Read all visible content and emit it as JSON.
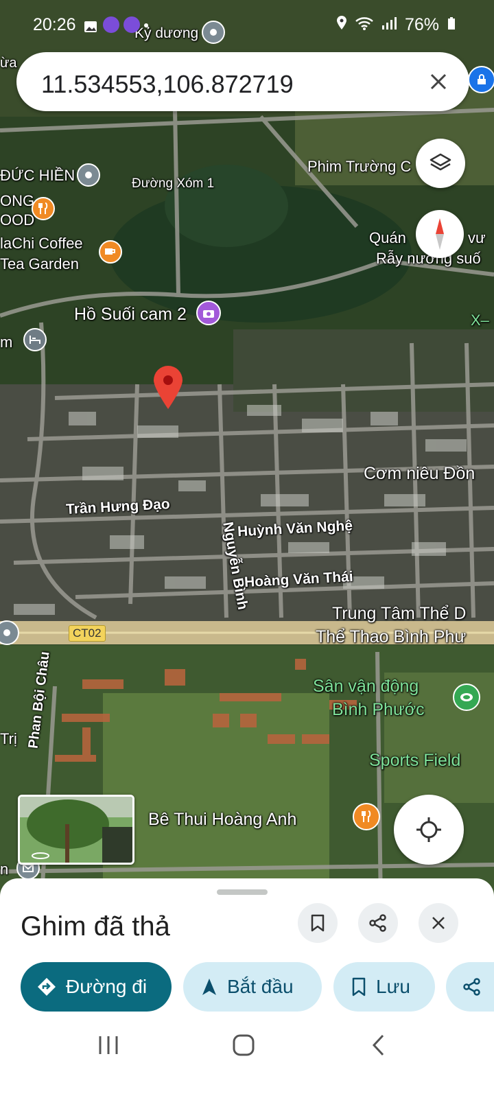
{
  "status": {
    "time": "20:26",
    "battery": "76%"
  },
  "search": {
    "query": "11.534553,106.872719"
  },
  "map": {
    "labels": {
      "ky_duong": "Kỷ dương",
      "dua": "ừa",
      "duc_hien": "ĐỨC HIỀN",
      "duong_xom1": "Đường Xóm 1",
      "ong": "ONG",
      "ood": "OOD",
      "nachi": "laChi Coffee",
      "tea": "Tea Garden",
      "phim_truong": "Phim Trường C",
      "quan": "Quán",
      "quan2": "vư",
      "ray": "Rẫy nướng suố",
      "ho_suoi": "Hồ Suối cam 2",
      "x": "X–",
      "m": "m",
      "com_nieu": "Cơm niêu Đồn",
      "tran_hung_dao": "Trần Hưng Đạo",
      "huynh_van_nghe": "Huỳnh Văn Nghệ",
      "nguyen_binh": "Nguyễn Bình",
      "hoang_van_thai": "Hoàng Văn Thái",
      "trung_tam1": "Trung Tâm Thể D",
      "trung_tam2": "Thể Thao Bình Phư",
      "ct02": "CT02",
      "phan_boi_chau": "Phan Bội Châu",
      "san1": "Sân vận động",
      "san2": "Bình Phước",
      "tri": "Trị",
      "sports": "Sports Field",
      "be_thui": "Bê Thui Hoàng Anh",
      "n": "n"
    }
  },
  "sheet": {
    "title": "Ghim đã thả",
    "chips": {
      "directions": "Đường đi",
      "start": "Bắt đầu",
      "save": "Lưu"
    }
  },
  "colors": {
    "primary": "#0b6b7f",
    "chip_bg": "#d3ecf5",
    "pin": "#ea4335"
  }
}
